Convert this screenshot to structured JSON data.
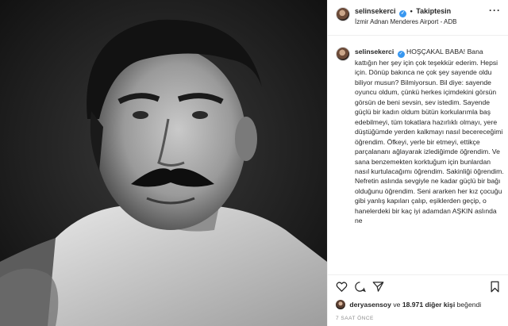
{
  "header": {
    "username": "selinsekerci",
    "follow_status": "Takiptesin",
    "location": "İzmir Adnan Menderes Airport - ADB",
    "more_icon": "ellipsis-icon"
  },
  "caption": {
    "username": "selinsekerci",
    "text": "HOŞÇAKAL BABA! Bana kattığın her şey için çok teşekkür ederim. Hepsi için. Dönüp bakınca ne çok şey sayende oldu biliyor musun? Bilmiyorsun. Bil diye: sayende oyuncu oldum, çünkü herkes içimdekini görsün görsün de beni sevsin, sev istedim. Sayende güçlü bir kadın oldum bütün korkularımla baş edebilmeyi, tüm tokatlara hazırlıklı olmayı, yere düştüğümde yerden kalkmayı nasıl becereceğimi öğrendim. Öfkeyi, yerle bir etmeyi, ettikçe parçalananı ağlayarak izlediğimde öğrendim. Ve sana benzemekten korktuğum için bunlardan nasıl kurtulacağımı öğrendim. Sakinliği öğrendim. Nefretin aslında sevgiyle ne kadar güçlü bir bağı olduğunu öğrendim. Seni ararken her kız çocuğu gibi yanlış kapıları çalıp, eşiklerden geçip, o hanelerdeki bir kaç iyi adamdan AŞKIN aslında ne"
  },
  "actions": {
    "like_icon": "heart-icon",
    "comment_icon": "comment-icon",
    "share_icon": "share-icon",
    "save_icon": "bookmark-icon"
  },
  "likes": {
    "first_user": "deryasensoy",
    "connector": "ve",
    "count": "18.971 diğer kişi",
    "suffix": "beğendi"
  },
  "timestamp": "7 SAAT ÖNCE"
}
